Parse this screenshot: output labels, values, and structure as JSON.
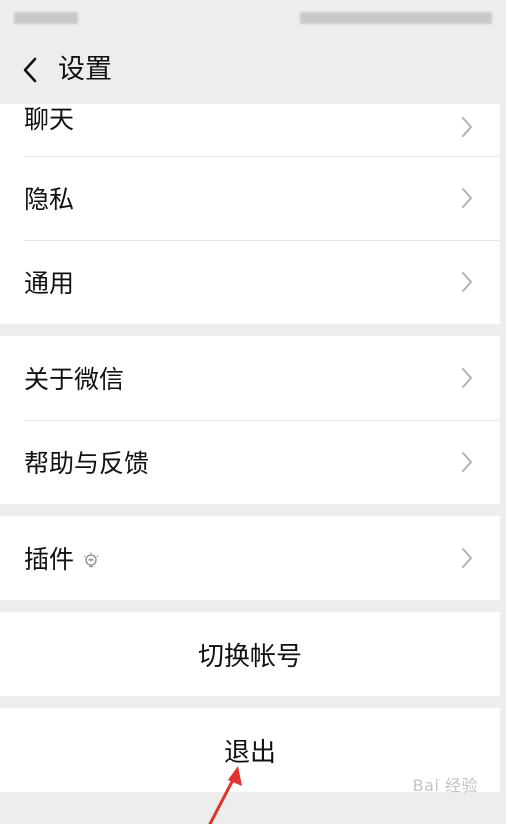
{
  "nav": {
    "title": "设置",
    "back_icon": "chevron-left-icon"
  },
  "groups": [
    {
      "items": [
        {
          "label": "聊天"
        },
        {
          "label": "隐私"
        },
        {
          "label": "通用"
        }
      ]
    },
    {
      "items": [
        {
          "label": "关于微信"
        },
        {
          "label": "帮助与反馈"
        }
      ]
    },
    {
      "items": [
        {
          "label": "插件",
          "icon": "lightbulb-icon"
        }
      ]
    }
  ],
  "actions": {
    "switch_account": "切换帐号",
    "logout": "退出"
  },
  "watermark": "Bai 经验",
  "colors": {
    "background": "#ededed",
    "cell": "#ffffff",
    "chevron": "#b2b2b2",
    "annotation_arrow": "#e0332e"
  }
}
